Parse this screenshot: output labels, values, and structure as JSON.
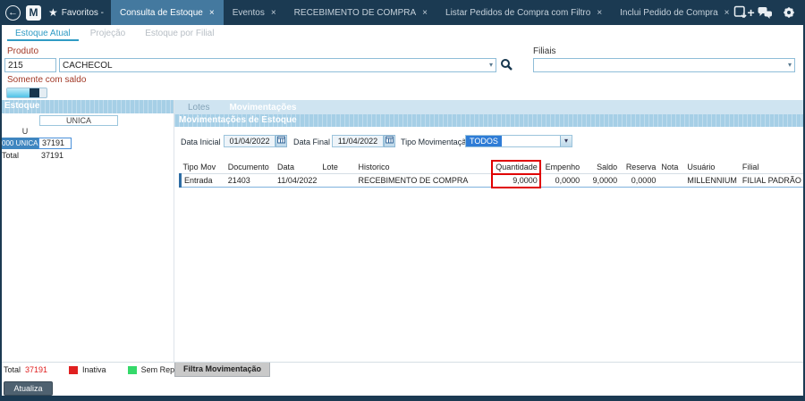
{
  "topbar": {
    "back_glyph": "←",
    "logo_letter": "M",
    "star_glyph": "★",
    "favorites_label": "Favoritos -",
    "close_glyph": "×",
    "new_tab_glyph": "+",
    "tabs": [
      {
        "label": "Consulta de Estoque"
      },
      {
        "label": "Eventos"
      },
      {
        "label": "RECEBIMENTO DE COMPRA"
      },
      {
        "label": "Listar Pedidos de Compra com Filtro"
      },
      {
        "label": "Inclui Pedido de Compra"
      }
    ]
  },
  "view_tabs": {
    "items": [
      {
        "label": "Estoque Atual"
      },
      {
        "label": "Projeção"
      },
      {
        "label": "Estoque por Filial"
      }
    ]
  },
  "form": {
    "produto_label": "Produto",
    "produto_code": "215",
    "produto_name": "CACHECOL",
    "filiais_label": "Filiais",
    "somente_saldo_label": "Somente com saldo",
    "chevron_glyph": "▾"
  },
  "estoque_panel": {
    "header": "Estoque",
    "size_group_header": "UNICA",
    "size_column": "U",
    "color_row_label": "000 UNICA",
    "color_row_value": "37191",
    "total_label": "Total",
    "total_value": "37191"
  },
  "mov_panel": {
    "tab_lotes": "Lotes",
    "tab_movimentacoes": "Movimentações",
    "header": "Movimentações de Estoque",
    "filter": {
      "data_inicial_label": "Data Inicial",
      "data_inicial_value": "01/04/2022",
      "data_final_label": "Data Final",
      "data_final_value": "11/04/2022",
      "tipo_label": "Tipo Movimentação",
      "tipo_value": "TODOS"
    },
    "table": {
      "columns": [
        "Tipo Mov",
        "Documento",
        "Data",
        "Lote",
        "Historico",
        "Quantidade",
        "Empenho",
        "Saldo",
        "Reserva",
        "Nota",
        "Usuário",
        "Filial"
      ],
      "rows": [
        [
          "Entrada",
          "21403",
          "11/04/2022",
          "",
          "RECEBIMENTO DE COMPRA",
          "9,0000",
          "0,0000",
          "9,0000",
          "0,0000",
          "",
          "MILLENNIUM",
          "FILIAL PADRÃO"
        ]
      ]
    }
  },
  "footer": {
    "total_label": "Total",
    "total_value": "37191",
    "inativa_label": "Inativa",
    "sem_reposicao_label": "Sem Reposição",
    "filtra_button": "Filtra Movimentação",
    "atualiza_button": "Atualiza"
  },
  "colors": {
    "topbar": "#1b3a52",
    "active_tab": "#44799f",
    "section_header": "#a6cfe6",
    "label_red": "#a23a28",
    "selection_blue": "#3f86c0",
    "todos_highlight": "#2e7cd6",
    "annotation_red": "#e00000",
    "legend_red": "#e02020",
    "legend_green": "#35d96a"
  }
}
